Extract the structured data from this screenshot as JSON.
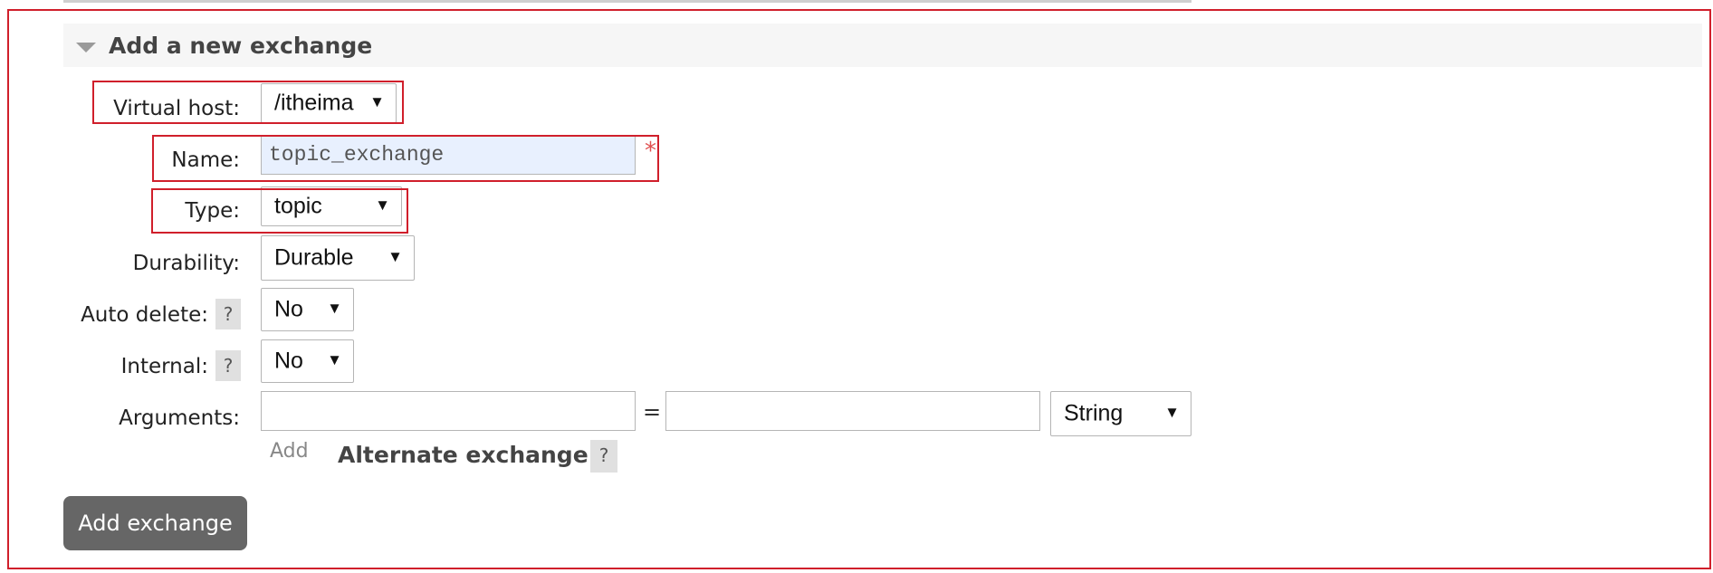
{
  "section": {
    "title": "Add a new exchange"
  },
  "form": {
    "virtual_host": {
      "label": "Virtual host:",
      "value": "/itheima"
    },
    "name": {
      "label": "Name:",
      "value": "topic_exchange",
      "required_mark": "*"
    },
    "type": {
      "label": "Type:",
      "value": "topic"
    },
    "durability": {
      "label": "Durability:",
      "value": "Durable"
    },
    "auto_delete": {
      "label": "Auto delete:",
      "value": "No",
      "help": "?"
    },
    "internal": {
      "label": "Internal:",
      "value": "No",
      "help": "?"
    },
    "arguments": {
      "label": "Arguments:",
      "key_value": "",
      "equals": "=",
      "value_value": "",
      "type_value": "String",
      "add_link": "Add",
      "alternate_exchange": "Alternate exchange",
      "help": "?"
    }
  },
  "submit": {
    "label": "Add exchange"
  },
  "colors": {
    "highlight": "#d01f2b",
    "button": "#666666",
    "autofill": "#e8f0fe"
  },
  "icons": {
    "collapse": "triangle-down-icon",
    "dropdown": "dropdown-arrow-icon"
  }
}
